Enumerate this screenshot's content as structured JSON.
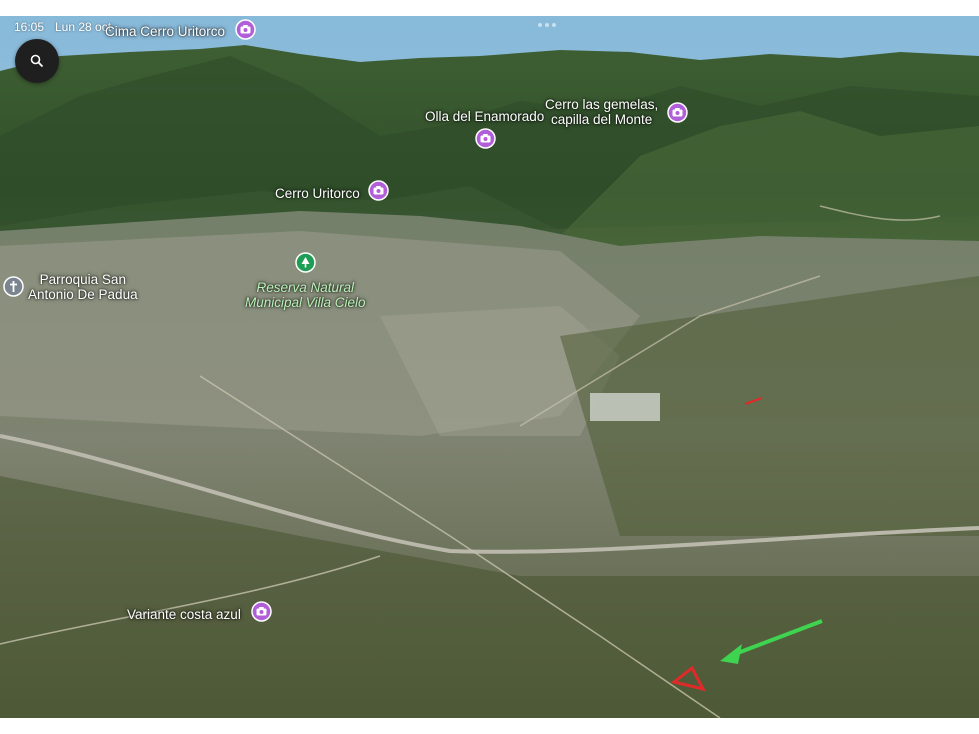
{
  "status_bar": {
    "time": "16:05",
    "date": "Lun 28 oct"
  },
  "places": [
    {
      "id": "cima",
      "name": "Cima Cerro Uritorco",
      "icon": "camera-icon"
    },
    {
      "id": "olla",
      "name": "Olla del Enamorado",
      "icon": "camera-icon"
    },
    {
      "id": "gemelas",
      "line1": "Cerro las gemelas,",
      "line2": "capilla del Monte",
      "icon": "camera-icon"
    },
    {
      "id": "uritorco",
      "name": "Cerro Uritorco",
      "icon": "camera-icon"
    },
    {
      "id": "parroquia",
      "line1": "Parroquia San",
      "line2": "Antonio De Padua",
      "icon": "church-icon"
    },
    {
      "id": "reserva",
      "line1": "Reserva Natural",
      "line2": "Municipal Villa Cielo",
      "icon": "tree-icon"
    },
    {
      "id": "variante",
      "name": "Variante costa azul",
      "icon": "camera-icon"
    }
  ],
  "colors": {
    "poi_purple": "#b15fd8",
    "park_green": "#1f9d55",
    "annotation_arrow": "#3fd44f",
    "annotation_triangle": "#e02a2a"
  }
}
